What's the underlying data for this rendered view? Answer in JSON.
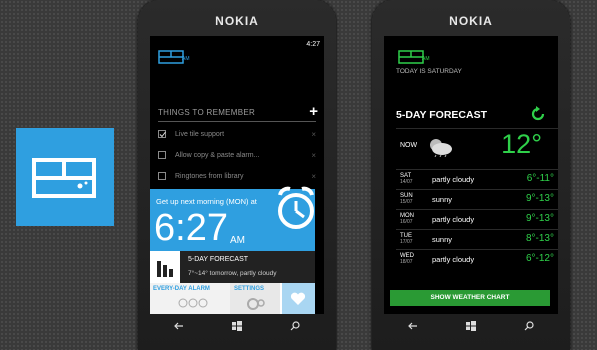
{
  "app_icon": {
    "name": "app-tile-icon",
    "color": "#2f9fe0"
  },
  "phone1": {
    "brand": "NOKIA",
    "time": "4:27",
    "logo_suffix": "AM",
    "todo_title": "THINGS TO REMEMBER",
    "add_icon": "+",
    "todos": [
      {
        "label": "Live tile support",
        "checked": true
      },
      {
        "label": "Allow copy & paste alarm...",
        "checked": false
      },
      {
        "label": "Ringtones from library",
        "checked": false
      }
    ],
    "alarm_caption": "Get up next morning (MON) at",
    "alarm_time": "6:27",
    "alarm_ampm": "AM",
    "forecast_title": "5-DAY FORECAST",
    "forecast_summary": "7°~14° tomorrow, partly cloudy",
    "tab_everyday": "EVERY-DAY ALARM",
    "tab_settings": "SETTINGS",
    "accent": "#2f9fe0"
  },
  "phone2": {
    "brand": "NOKIA",
    "logo_suffix": "AM",
    "today": "TODAY IS SATURDAY",
    "title": "5-DAY FORECAST",
    "now_label": "NOW",
    "now_temp": "12°",
    "rows": [
      {
        "day": "SAT",
        "date": "14/07",
        "desc": "partly cloudy",
        "temp": "6°-11°"
      },
      {
        "day": "SUN",
        "date": "15/07",
        "desc": "sunny",
        "temp": "9°-13°"
      },
      {
        "day": "MON",
        "date": "16/07",
        "desc": "partly cloudy",
        "temp": "9°-13°"
      },
      {
        "day": "TUE",
        "date": "17/07",
        "desc": "sunny",
        "temp": "8°-13°"
      },
      {
        "day": "WED",
        "date": "18/07",
        "desc": "partly cloudy",
        "temp": "6°-12°"
      }
    ],
    "show_chart": "SHOW WEATHER CHART",
    "accent": "#2fd04a",
    "button_color": "#2a9a34"
  }
}
